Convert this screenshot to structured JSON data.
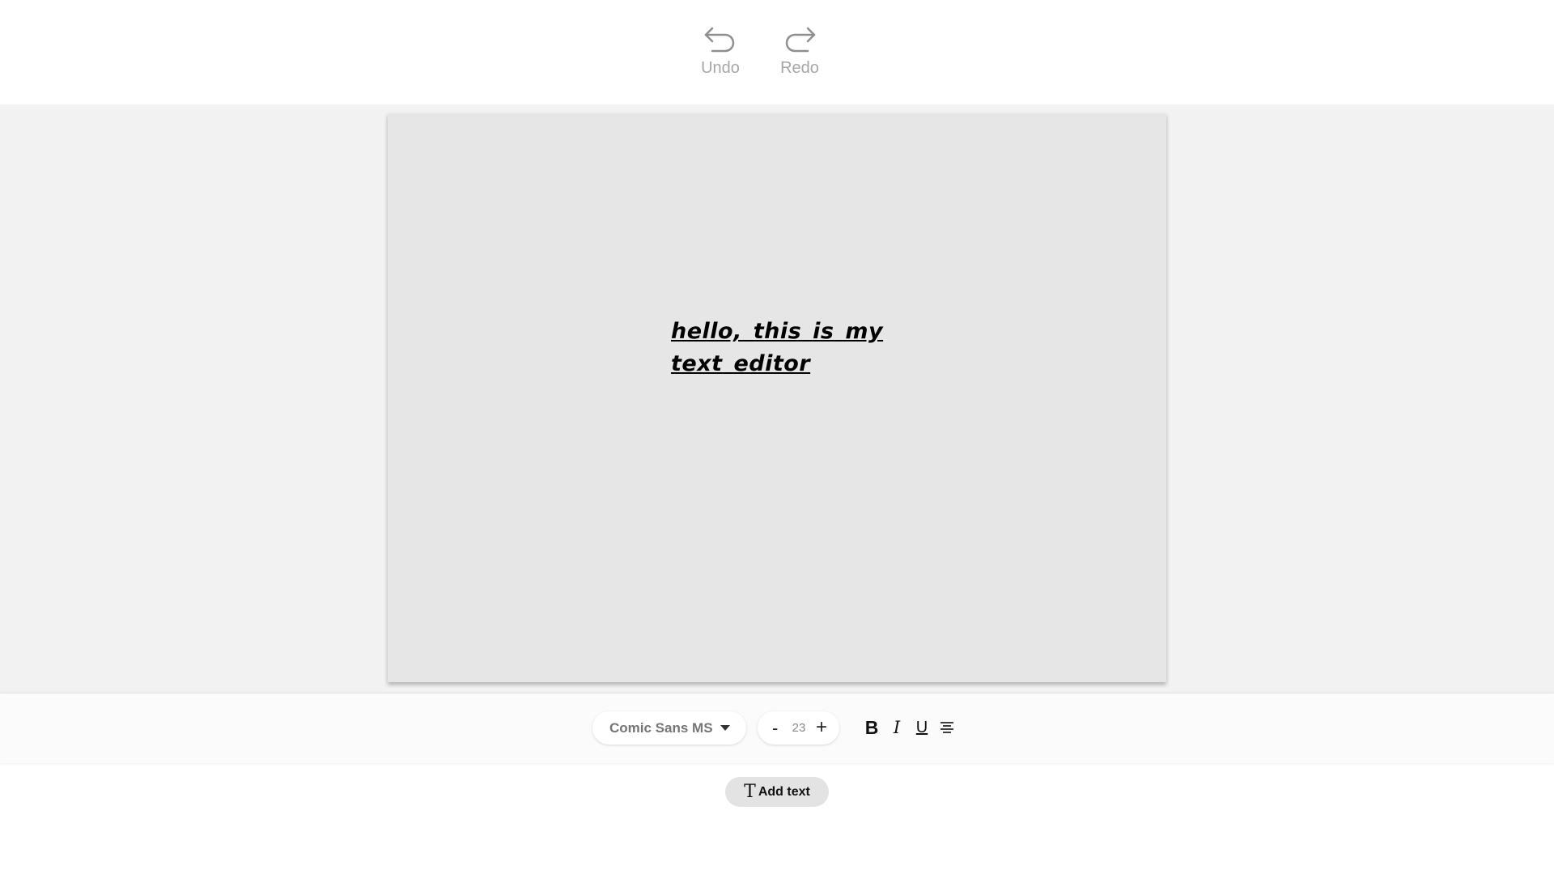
{
  "history": {
    "undo_label": "Undo",
    "redo_label": "Redo",
    "undo_icon": "undo-arrow-icon",
    "redo_icon": "redo-arrow-icon"
  },
  "canvas": {
    "text": "hello, this is my text editor",
    "background": "#e6e6e6",
    "text_style": {
      "bold": true,
      "italic": true,
      "underline": true
    }
  },
  "format_toolbar": {
    "font_family": "Comic Sans MS",
    "font_size": "23",
    "decrease_label": "-",
    "increase_label": "+",
    "bold_label": "B",
    "italic_label": "I",
    "underline_label": "U",
    "align_icon": "align-center-icon"
  },
  "add_text": {
    "icon": "T",
    "label": "Add text"
  },
  "colors": {
    "workspace": "#f2f2f2",
    "muted_label": "#a6a6a6",
    "add_text_bg": "#e3e3e3"
  }
}
